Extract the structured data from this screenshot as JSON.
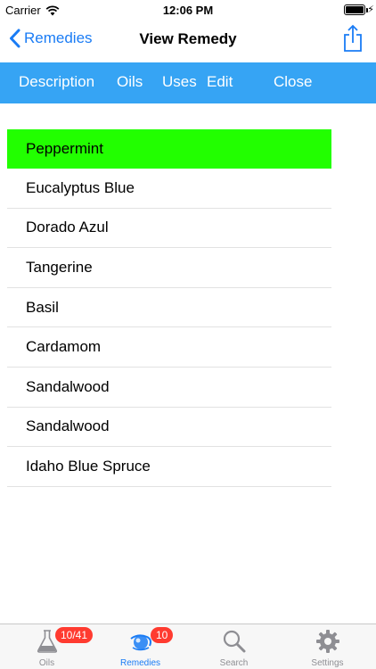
{
  "status_bar": {
    "carrier": "Carrier",
    "time": "12:06 PM",
    "charging_symbol": "⚡"
  },
  "nav": {
    "back_label": "Remedies",
    "title": "View Remedy",
    "back_icon": "chevron-left-icon",
    "share_icon": "share-icon"
  },
  "toolbar": {
    "items": [
      "Description",
      "Oils",
      "Uses",
      "Edit",
      "Close"
    ]
  },
  "oil_list": {
    "selected_index": 0,
    "selected_color": "#22ff00",
    "items": [
      "Peppermint",
      "Eucalyptus Blue",
      "Dorado Azul",
      "Tangerine",
      "Basil",
      "Cardamom",
      "Sandalwood",
      "Sandalwood",
      "Idaho Blue Spruce"
    ]
  },
  "tab_bar": {
    "active_index": 1,
    "tabs": [
      {
        "label": "Oils",
        "icon": "flask-icon",
        "badge": "10/41"
      },
      {
        "label": "Remedies",
        "icon": "remedies-swirl-icon",
        "badge": "10"
      },
      {
        "label": "Search",
        "icon": "magnifier-icon",
        "badge": ""
      },
      {
        "label": "Settings",
        "icon": "gear-icon",
        "badge": ""
      }
    ]
  },
  "colors": {
    "accent": "#1a7cf5",
    "toolbar": "#36a4f4",
    "badge": "#ff3b30"
  }
}
